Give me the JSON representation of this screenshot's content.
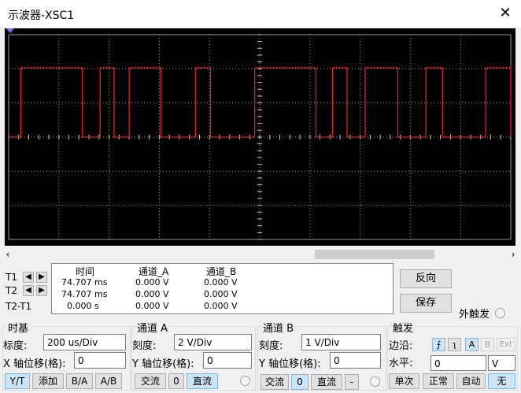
{
  "window": {
    "title": "示波器-XSC1"
  },
  "readout": {
    "headers": {
      "time": "时间",
      "channel_a": "通道_A",
      "channel_b": "通道_B"
    },
    "rows": [
      {
        "label": "T1",
        "time": "74.707 ms",
        "a": "0.000 V",
        "b": "0.000 V"
      },
      {
        "label": "T2",
        "time": "74.707 ms",
        "a": "0.000 V",
        "b": "0.000 V"
      },
      {
        "label": "T2-T1",
        "time": "0.000 s",
        "a": "0.000 V",
        "b": "0.000 V"
      }
    ]
  },
  "buttons": {
    "reverse": "反向",
    "save": "保存",
    "ext_trigger": "外触发"
  },
  "timebase": {
    "title": "时基",
    "scale_label": "标度:",
    "scale_value": "200 us/Div",
    "xpos_label": "X 轴位移(格):",
    "xpos_value": "0",
    "modes": [
      "Y/T",
      "添加",
      "B/A",
      "A/B"
    ]
  },
  "channel_a": {
    "title": "通道 A",
    "scale_label": "刻度:",
    "scale_value": "2  V/Div",
    "ypos_label": "Y 轴位移(格):",
    "ypos_value": "0",
    "coupling": [
      "交流",
      "0",
      "直流"
    ]
  },
  "channel_b": {
    "title": "通道 B",
    "scale_label": "刻度:",
    "scale_value": "1  V/Div",
    "ypos_label": "Y 轴位移(格):",
    "ypos_value": "0",
    "coupling": [
      "交流",
      "0",
      "直流",
      "-"
    ]
  },
  "trigger": {
    "title": "触发",
    "edge_label": "边沿:",
    "sources": [
      "A",
      "B",
      "Ext"
    ],
    "level_label": "水平:",
    "level_value": "0",
    "level_unit": "V",
    "modes": [
      "单次",
      "正常",
      "自动",
      "无"
    ]
  },
  "colors": {
    "trace_a": "#e02020",
    "grid": "#9a9a9a",
    "screen": "#000000"
  },
  "waveform": {
    "channel": "A",
    "low": 0,
    "high": 1,
    "segments": [
      [
        0.0,
        0.0,
        0
      ],
      [
        0.0,
        0.012,
        0
      ],
      [
        0.024,
        0.147,
        1
      ],
      [
        0.182,
        0.21,
        1
      ],
      [
        0.24,
        0.303,
        1
      ],
      [
        0.372,
        0.402,
        1
      ],
      [
        0.49,
        0.612,
        1
      ],
      [
        0.645,
        0.674,
        1
      ],
      [
        0.71,
        0.775,
        1
      ],
      [
        0.831,
        0.864,
        1
      ],
      [
        0.95,
        1.0,
        1
      ]
    ]
  }
}
